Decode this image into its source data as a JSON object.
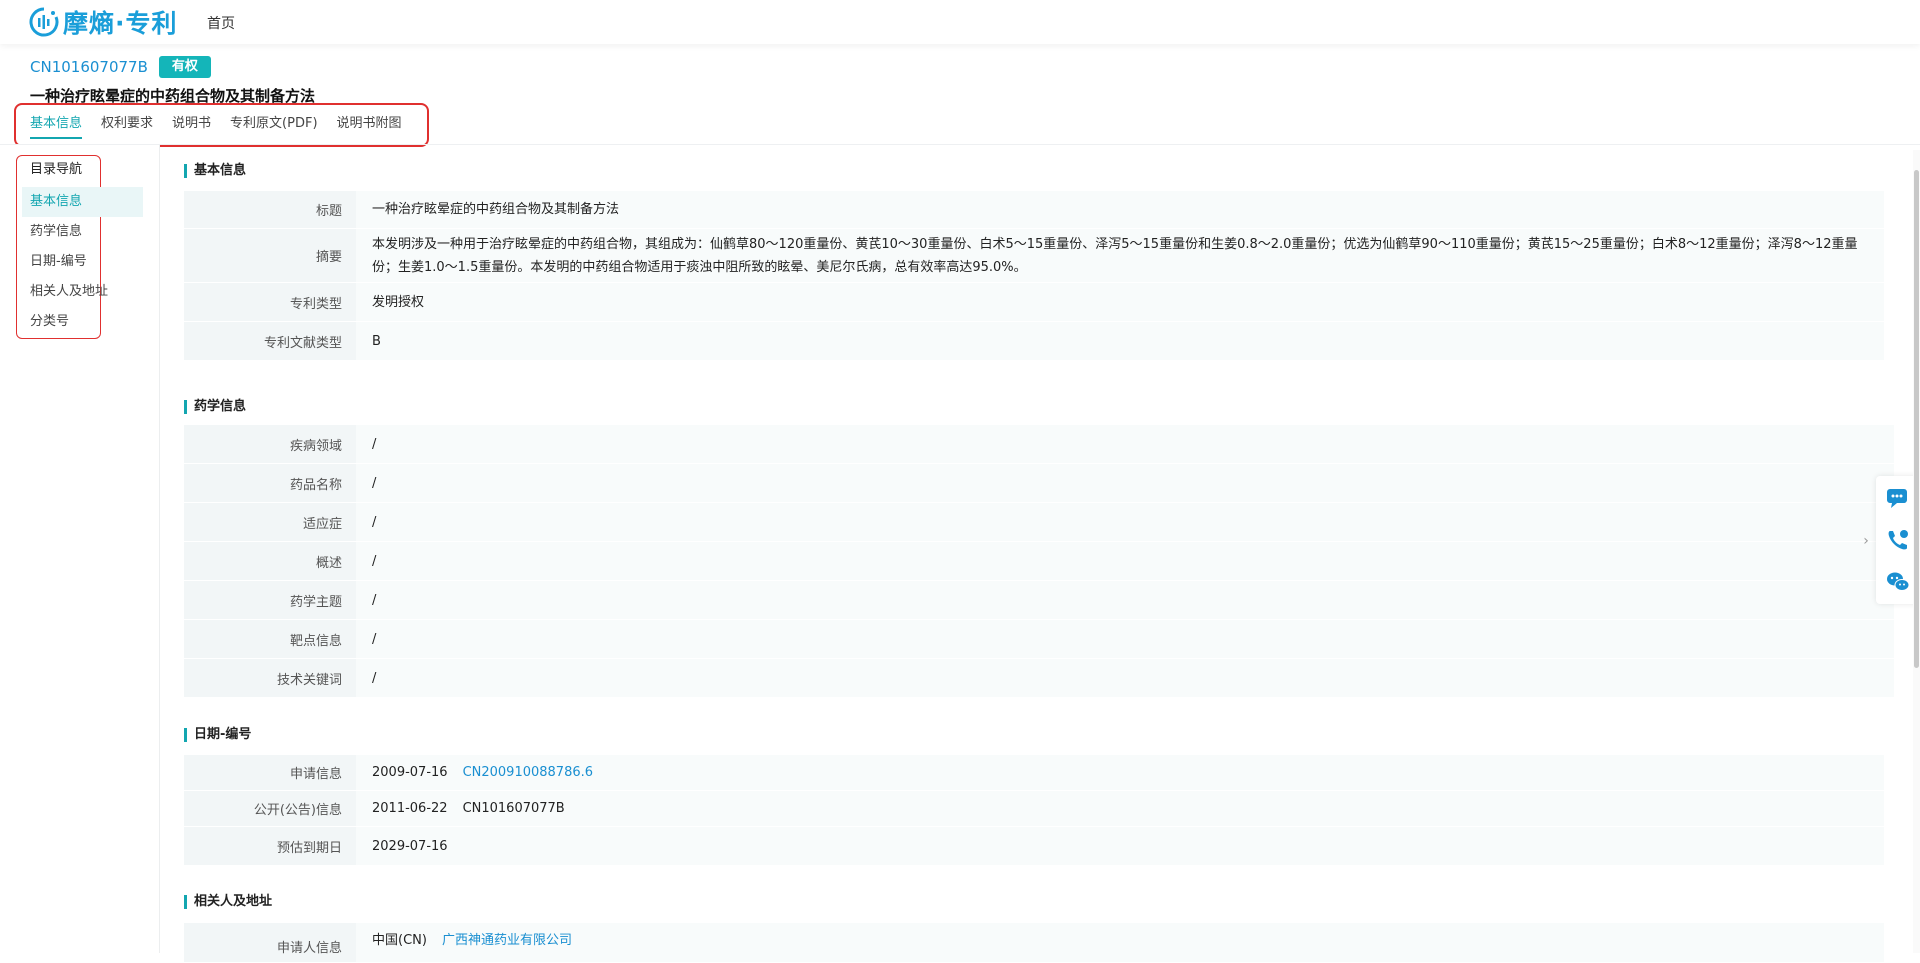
{
  "header": {
    "logo_text": "摩熵·专利",
    "nav_home": "首页"
  },
  "patent": {
    "number": "CN101607077B",
    "status_badge": "有权",
    "title": "一种治疗眩晕症的中药组合物及其制备方法"
  },
  "tabs": [
    {
      "label": "基本信息",
      "active": true
    },
    {
      "label": "权利要求"
    },
    {
      "label": "说明书"
    },
    {
      "label": "专利原文(PDF)"
    },
    {
      "label": "说明书附图"
    }
  ],
  "sidebar": {
    "title": "目录导航",
    "items": [
      {
        "label": "基本信息",
        "active": true
      },
      {
        "label": "药学信息"
      },
      {
        "label": "日期-编号"
      },
      {
        "label": "相关人及地址"
      },
      {
        "label": "分类号"
      }
    ]
  },
  "sections": {
    "basic": {
      "title": "基本信息",
      "rows": [
        {
          "label": "标题",
          "value": "一种治疗眩晕症的中药组合物及其制备方法"
        },
        {
          "label": "摘要",
          "value": "本发明涉及一种用于治疗眩晕症的中药组合物，其组成为：仙鹤草80～120重量份、黄芪10～30重量份、白术5～15重量份、泽泻5～15重量份和生姜0.8～2.0重量份；优选为仙鹤草90～110重量份；黄芪15～25重量份；白术8～12重量份；泽泻8～12重量份；生姜1.0～1.5重量份。本发明的中药组合物适用于痰浊中阻所致的眩晕、美尼尔氏病，总有效率高达95.0%。"
        },
        {
          "label": "专利类型",
          "value": "发明授权"
        },
        {
          "label": "专利文献类型",
          "value": "B"
        }
      ]
    },
    "pharma": {
      "title": "药学信息",
      "rows": [
        {
          "label": "疾病领域",
          "value": "/"
        },
        {
          "label": "药品名称",
          "value": "/"
        },
        {
          "label": "适应症",
          "value": "/"
        },
        {
          "label": "概述",
          "value": "/"
        },
        {
          "label": "药学主题",
          "value": "/"
        },
        {
          "label": "靶点信息",
          "value": "/"
        },
        {
          "label": "技术关键词",
          "value": "/"
        }
      ]
    },
    "dates": {
      "title": "日期-编号",
      "rows": [
        {
          "label": "申请信息",
          "date": "2009-07-16",
          "code": "CN200910088786.6"
        },
        {
          "label": "公开(公告)信息",
          "date": "2011-06-22",
          "code": "CN101607077B"
        },
        {
          "label": "预估到期日",
          "date": "2029-07-16"
        }
      ]
    },
    "parties": {
      "title": "相关人及地址",
      "rows": [
        {
          "label": "申请人信息",
          "country": "中国(CN)",
          "company": "广西神通药业有限公司"
        }
      ]
    }
  },
  "colors": {
    "accent": "#13a6b0",
    "link": "#1a8fd1",
    "highlight_box": "#e0302f"
  },
  "float_icons": [
    "chat-icon",
    "phone-icon",
    "wechat-icon"
  ]
}
